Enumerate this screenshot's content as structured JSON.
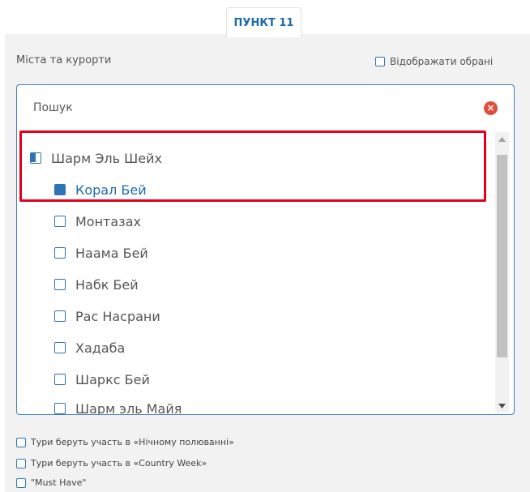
{
  "header": {
    "step_label": "ПУНКТ 11"
  },
  "section": {
    "label": "Міста та курорти",
    "show_selected_label": "Відображати обрані"
  },
  "search": {
    "placeholder": "Пошук"
  },
  "items": [
    {
      "label": "Шарм Эль Шейх",
      "state": "partial"
    },
    {
      "label": "Корал Бей",
      "state": "checked"
    },
    {
      "label": "Монтазах",
      "state": "unchecked"
    },
    {
      "label": "Наама Бей",
      "state": "unchecked"
    },
    {
      "label": "Набк Бей",
      "state": "unchecked"
    },
    {
      "label": "Рас Насрани",
      "state": "unchecked"
    },
    {
      "label": "Хадаба",
      "state": "unchecked"
    },
    {
      "label": "Шаркс Бей",
      "state": "unchecked"
    },
    {
      "label": "Шарм эль Майя",
      "state": "unchecked"
    }
  ],
  "filters": [
    {
      "label": "Тури беруть участь в «Нічному полюванні»"
    },
    {
      "label": "Тури беруть участь в «Country Week»"
    },
    {
      "label": "\"Must Have\""
    }
  ],
  "colors": {
    "accent": "#2e74b5",
    "highlight": "#e3001b",
    "clear": "#e24c3b"
  }
}
